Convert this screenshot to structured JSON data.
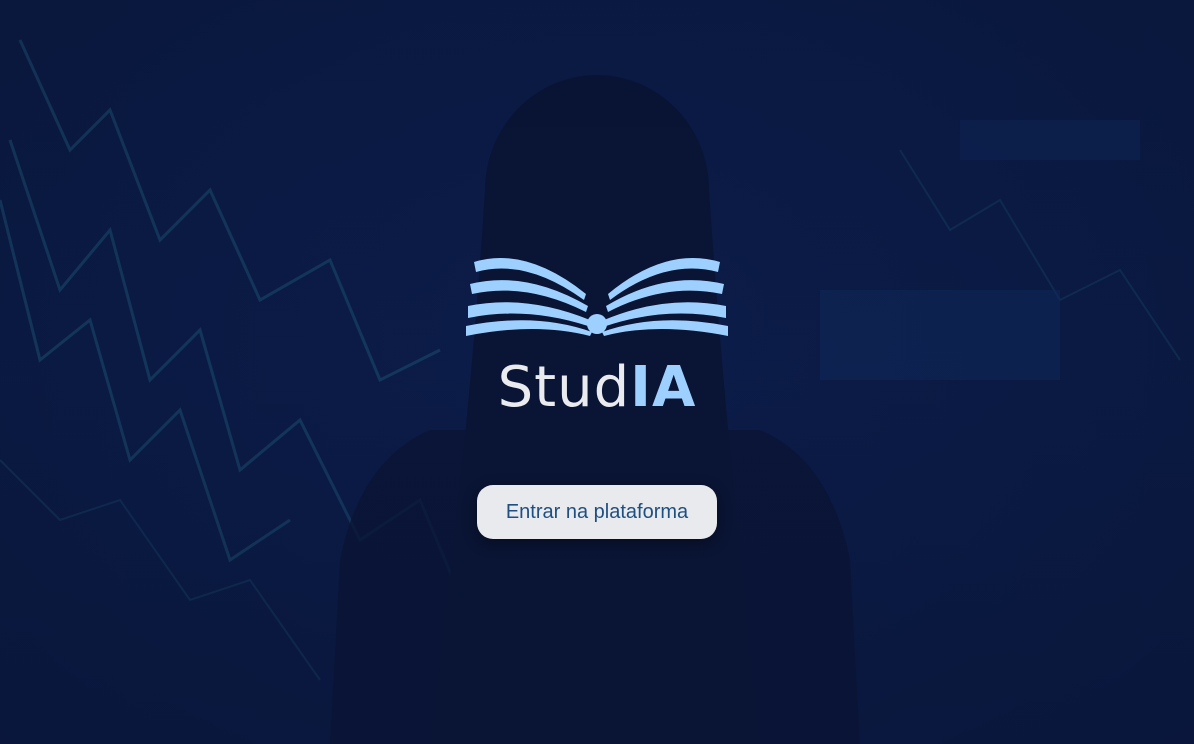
{
  "brand": {
    "name_part1": "Stud",
    "name_part2": "IA"
  },
  "actions": {
    "enter_label": "Entrar na plataforma"
  },
  "icons": {
    "logo": "open-book-icon"
  },
  "colors": {
    "background": "#0b1a44",
    "logo_blue": "#9dd0ff",
    "brand_text": "#e9ebef",
    "button_bg": "#e8eaee",
    "button_text": "#1f4f80"
  }
}
